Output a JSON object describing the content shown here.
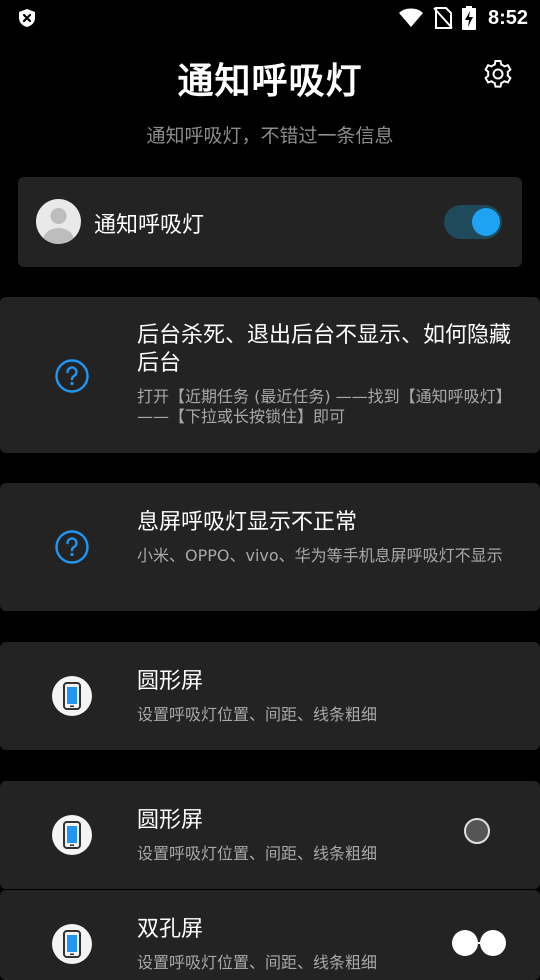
{
  "status_bar": {
    "time": "8:52",
    "left_icon": "shield-x-icon",
    "right_icons": [
      "wifi-icon",
      "no-sim-icon",
      "battery-charging-icon"
    ]
  },
  "header": {
    "title": "通知呼吸灯",
    "subtitle": "通知呼吸灯，不错过一条信息",
    "settings_icon": "gear-icon"
  },
  "master": {
    "label": "通知呼吸灯",
    "enabled": true,
    "accent_color": "#1ea3f3"
  },
  "cards": [
    {
      "icon": "help-circle-icon",
      "title": "后台杀死、退出后台不显示、如何隐藏后台",
      "desc": "打开【近期任务 (最近任务) ——找到【通知呼吸灯】——【下拉或长按锁住】即可"
    },
    {
      "icon": "help-circle-icon",
      "title": "息屏呼吸灯显示不正常",
      "desc": "小米、OPPO、vivo、华为等手机息屏呼吸灯不显示"
    },
    {
      "icon": "phone-icon",
      "title": "圆形屏",
      "desc": "设置呼吸灯位置、间距、线条粗细"
    },
    {
      "icon": "phone-icon",
      "title": "圆形屏",
      "desc": "设置呼吸灯位置、间距、线条粗细",
      "indicator": "single-hole"
    },
    {
      "icon": "phone-icon",
      "title": "双孔屏",
      "desc": "设置呼吸灯位置、间距、线条粗细",
      "indicator": "dual-hole"
    }
  ]
}
